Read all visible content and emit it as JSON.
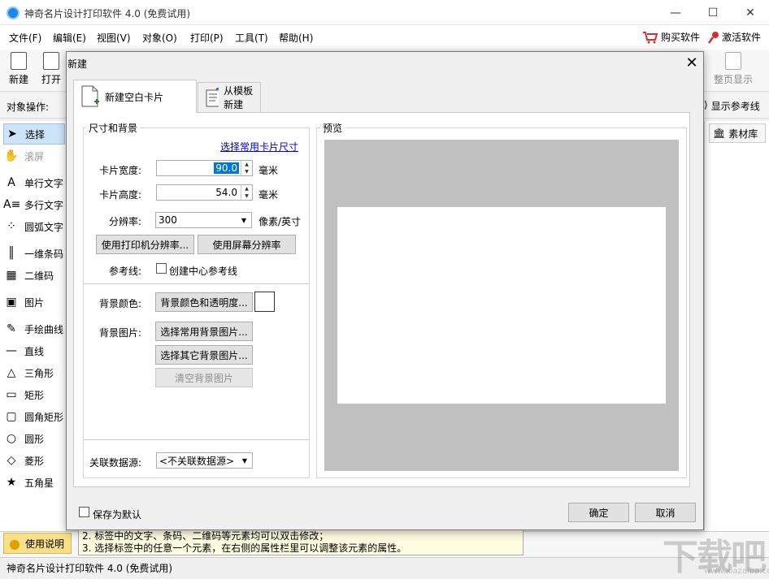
{
  "app": {
    "title": "神奇名片设计打印软件 4.0 (免费试用)",
    "menu": [
      "文件(F)",
      "编辑(E)",
      "视图(V)",
      "对象(O)",
      "打印(P)",
      "工具(T)",
      "帮助(H)"
    ],
    "buy": "购买软件",
    "activate": "激活软件",
    "window_controls": {
      "minimize": "—",
      "maximize": "☐",
      "close": "✕"
    }
  },
  "toolbar": {
    "new_label": "新建",
    "open_label": "打开",
    "fit_page_label": "整页显示"
  },
  "subbar": {
    "object_ops_label": "对象操作:",
    "show_guides_label": "显示参考线"
  },
  "left_panel": {
    "items": [
      "选择",
      "滚屏",
      "单行文字",
      "多行文字",
      "圆弧文字",
      "一维条码",
      "二维码",
      "图片",
      "手绘曲线",
      "直线",
      "三角形",
      "矩形",
      "圆角矩形",
      "圆形",
      "菱形",
      "五角星"
    ]
  },
  "right_panel": {
    "library_label": "素材库"
  },
  "help": {
    "button_label": "使用说明",
    "lines": [
      "2. 标签中的文字、条码、二维码等元素均可以双击修改；",
      "3. 选择标签中的任意一个元素，在右侧的属性栏里可以调整该元素的属性。"
    ]
  },
  "status": {
    "text": "神奇名片设计打印软件 4.0 (免费试用)"
  },
  "watermark": {
    "logo": "下载吧",
    "url": "www.xiazaiba.com"
  },
  "dialog": {
    "title": "新建",
    "close": "✕",
    "tabs": [
      "新建空白卡片",
      "从模板新建"
    ],
    "size_group": {
      "title": "尺寸和背景",
      "common_size_link": "选择常用卡片尺寸",
      "width_label": "卡片宽度:",
      "width_value": "90.0",
      "height_label": "卡片高度:",
      "height_value": "54.0",
      "unit_mm": "毫米",
      "dpi_label": "分辨率:",
      "dpi_value": "300",
      "dpi_unit": "像素/英寸",
      "printer_dpi_button": "使用打印机分辨率...",
      "screen_dpi_button": "使用屏幕分辨率",
      "guides_label": "参考线:",
      "center_guides_check": "创建中心参考线",
      "bg_color_label": "背景颜色:",
      "bg_color_button": "背景颜色和透明度...",
      "bg_color_value": "#ffffff",
      "bg_image_label": "背景图片:",
      "common_bg_button": "选择常用背景图片...",
      "other_bg_button": "选择其它背景图片...",
      "clear_bg_button": "清空背景图片",
      "datasource_label": "关联数据源:",
      "datasource_value": "<不关联数据源>"
    },
    "preview": {
      "title": "预览"
    },
    "save_default": "保存为默认",
    "ok": "确定",
    "cancel": "取消"
  }
}
